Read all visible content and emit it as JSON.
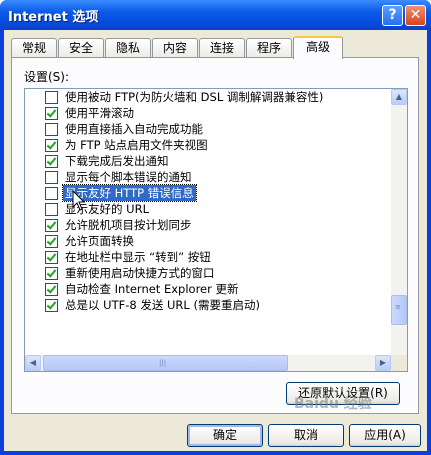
{
  "window": {
    "title": "Internet 选项"
  },
  "titlebar_buttons": {
    "help": "?",
    "close": "✕"
  },
  "tabs": [
    {
      "label": "常规",
      "active": false
    },
    {
      "label": "安全",
      "active": false
    },
    {
      "label": "隐私",
      "active": false
    },
    {
      "label": "内容",
      "active": false
    },
    {
      "label": "连接",
      "active": false
    },
    {
      "label": "程序",
      "active": false
    },
    {
      "label": "高级",
      "active": true
    }
  ],
  "settings_label": "设置(S):",
  "items": [
    {
      "label": "使用被动 FTP(为防火墙和 DSL 调制解调器兼容性)",
      "checked": false
    },
    {
      "label": "使用平滑滚动",
      "checked": true
    },
    {
      "label": "使用直接插入自动完成功能",
      "checked": false
    },
    {
      "label": "为 FTP 站点启用文件夹视图",
      "checked": true
    },
    {
      "label": "下载完成后发出通知",
      "checked": true
    },
    {
      "label": "显示每个脚本错误的通知",
      "checked": false
    },
    {
      "label": "显示友好 HTTP 错误信息",
      "checked": false,
      "selected": true
    },
    {
      "label": "显示友好的 URL",
      "checked": false
    },
    {
      "label": "允许脱机项目按计划同步",
      "checked": true
    },
    {
      "label": "允许页面转换",
      "checked": true
    },
    {
      "label": "在地址栏中显示 “转到” 按钮",
      "checked": true
    },
    {
      "label": "重新使用启动快捷方式的窗口",
      "checked": true
    },
    {
      "label": "自动检查 Internet Explorer 更新",
      "checked": true
    },
    {
      "label": "总是以 UTF-8 发送 URL (需要重启动)",
      "checked": true
    }
  ],
  "restore_button": "还原默认设置(R)",
  "footer": {
    "ok": "确定",
    "cancel": "取消",
    "apply": "应用(A)"
  },
  "watermark": "Baidu 经验",
  "colors": {
    "titlebar": "#0a5ae8",
    "selection": "#316ac5",
    "checkmark": "#21a121",
    "face": "#ece9d8"
  }
}
